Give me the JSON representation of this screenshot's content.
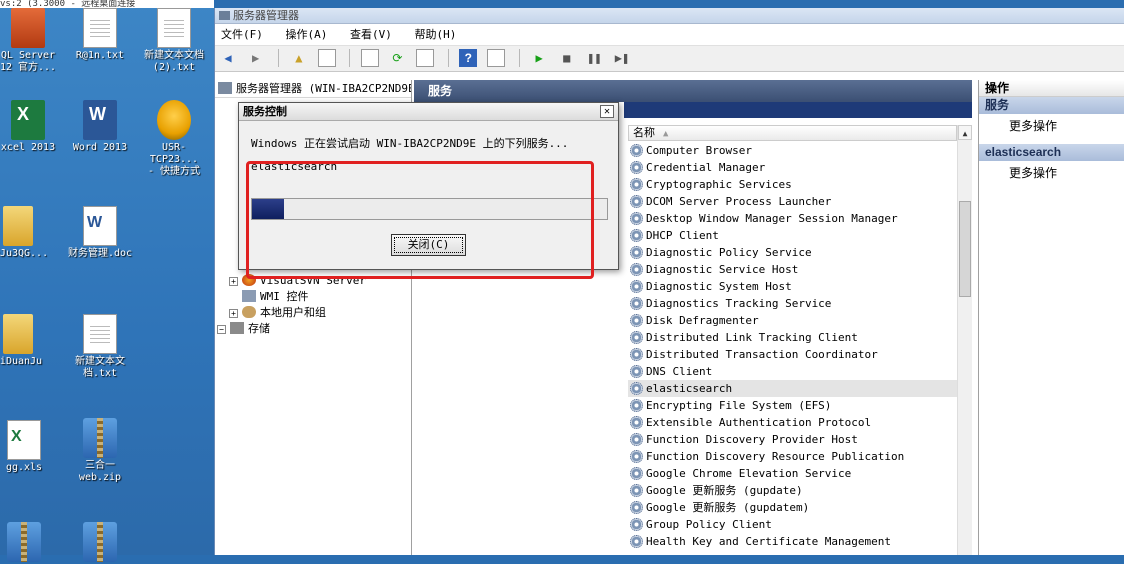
{
  "desktop": {
    "top_text": "vs:2 (3.3000 - 远程桌面连接",
    "icons": [
      {
        "label": "QL Server\n12 官方..."
      },
      {
        "label": "R@1n.txt"
      },
      {
        "label": "新建文本文档\n(2).txt"
      },
      {
        "label": "xcel 2013"
      },
      {
        "label": "Word 2013"
      },
      {
        "label": "USR-TCP23...\n- 快捷方式"
      },
      {
        "label": "anJu3QG..."
      },
      {
        "label": "财务管理.doc"
      },
      {
        "label": "hiDuanJu"
      },
      {
        "label": "新建文本文\n档.txt"
      },
      {
        "label": "gg.xls"
      },
      {
        "label": "三合一\nweb.zip"
      }
    ]
  },
  "window": {
    "title": "服务器管理器",
    "menu": [
      "文件(F)",
      "操作(A)",
      "查看(V)",
      "帮助(H)"
    ]
  },
  "tree": {
    "header": "服务器管理器 (WIN-IBA2CP2ND9E)",
    "nodes": [
      {
        "label": "VisualSVN Server"
      },
      {
        "label": "WMI 控件"
      },
      {
        "label": "本地用户和组"
      },
      {
        "label": "存储"
      }
    ]
  },
  "center": {
    "header": "服务",
    "column_name": "名称",
    "services": [
      "Computer Browser",
      "Credential Manager",
      "Cryptographic Services",
      "DCOM Server Process Launcher",
      "Desktop Window Manager Session Manager",
      "DHCP Client",
      "Diagnostic Policy Service",
      "Diagnostic Service Host",
      "Diagnostic System Host",
      "Diagnostics Tracking Service",
      "Disk Defragmenter",
      "Distributed Link Tracking Client",
      "Distributed Transaction Coordinator",
      "DNS Client",
      "elasticsearch",
      "Encrypting File System (EFS)",
      "Extensible Authentication Protocol",
      "Function Discovery Provider Host",
      "Function Discovery Resource Publication",
      "Google Chrome Elevation Service",
      "Google 更新服务 (gupdate)",
      "Google 更新服务 (gupdatem)",
      "Group Policy Client",
      "Health Key and Certificate Management"
    ],
    "selected_index": 14
  },
  "actions": {
    "title": "操作",
    "section1": "服务",
    "section1_item": "更多操作",
    "section2": "elasticsearch",
    "section2_item": "更多操作"
  },
  "dialog": {
    "title": "服务控制",
    "close_glyph": "✕",
    "message": "Windows 正在尝试启动 WIN-IBA2CP2ND9E 上的下列服务...",
    "service": "elasticsearch",
    "progress": 0.09,
    "button": "关闭(C)"
  },
  "colors": {
    "highlight_box": "#e02020",
    "progress_fill": "#1a2c72"
  }
}
